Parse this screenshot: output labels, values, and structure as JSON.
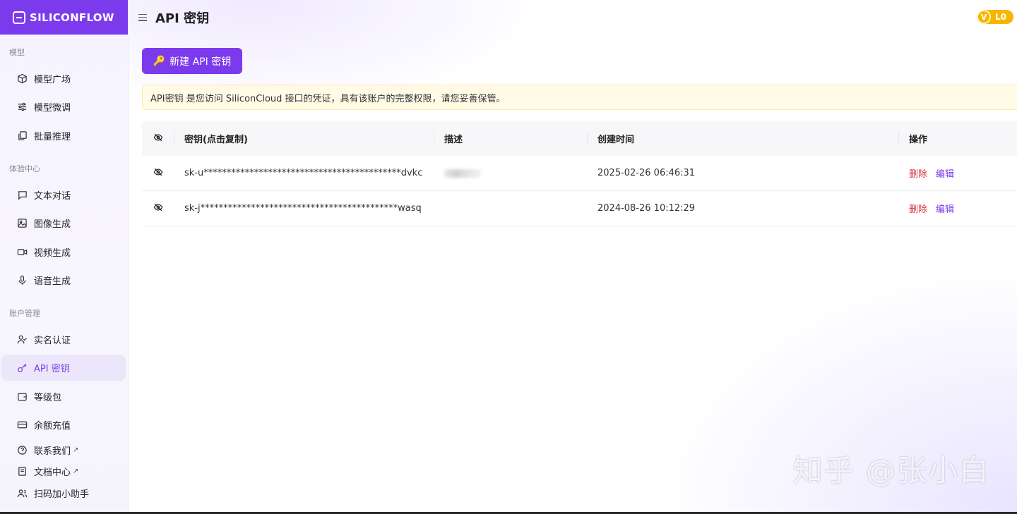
{
  "brand": {
    "logo_text": "SILICONFLOW",
    "color": "#7c3aed"
  },
  "header": {
    "title": "API 密钥",
    "level_badge": "L0",
    "level_icon_text": "V"
  },
  "sidebar": {
    "sections": [
      {
        "label": "模型"
      },
      {
        "label": "体验中心"
      },
      {
        "label": "账户管理"
      }
    ],
    "items": [
      {
        "label": "模型广场",
        "icon": "cube-icon"
      },
      {
        "label": "模型微调",
        "icon": "sliders-icon"
      },
      {
        "label": "批量推理",
        "icon": "copy-icon"
      },
      {
        "label": "文本对话",
        "icon": "chat-icon"
      },
      {
        "label": "图像生成",
        "icon": "image-icon"
      },
      {
        "label": "视频生成",
        "icon": "video-icon"
      },
      {
        "label": "语音生成",
        "icon": "mic-icon"
      },
      {
        "label": "实名认证",
        "icon": "user-check-icon"
      },
      {
        "label": "API 密钥",
        "icon": "key-icon",
        "active": true
      },
      {
        "label": "等级包",
        "icon": "wallet-icon"
      },
      {
        "label": "余额充值",
        "icon": "card-icon"
      },
      {
        "label": "联系我们",
        "icon": "help-circle-icon",
        "external": "↗"
      },
      {
        "label": "文档中心",
        "icon": "doc-icon",
        "external": "↗"
      },
      {
        "label": "扫码加小助手",
        "icon": "users-icon"
      }
    ]
  },
  "actions": {
    "new_key_label": "新建 API 密钥",
    "new_key_emoji": "🔑"
  },
  "notice": {
    "text": "API密钥 是您访问 SiliconCloud 接口的凭证，具有该账户的完整权限，请您妥善保管。"
  },
  "table": {
    "columns": {
      "key": "密钥(点击复制)",
      "desc": "描述",
      "time": "创建时间",
      "ops": "操作"
    },
    "rows": [
      {
        "key": "sk-u*******************************************dvkc",
        "desc": "",
        "time": "2025-02-26 06:46:31",
        "delete": "删除",
        "edit": "编辑"
      },
      {
        "key": "sk-j*******************************************wasq",
        "desc": "",
        "time": "2024-08-26 10:12:29",
        "delete": "删除",
        "edit": "编辑"
      }
    ]
  },
  "watermark": "知乎 @张小白"
}
